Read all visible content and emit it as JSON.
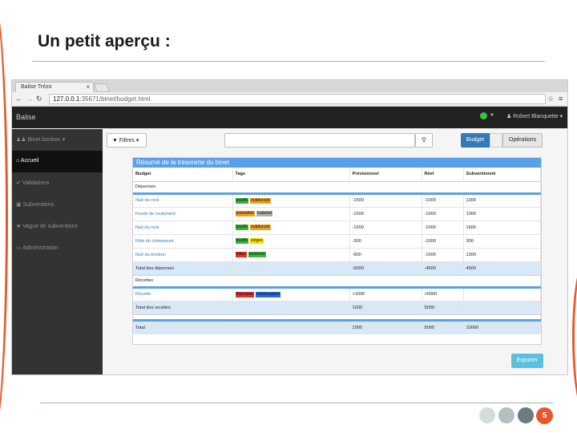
{
  "slide": {
    "title": "Un petit aperçu :",
    "page_number": "5",
    "accent_color": "#e8572a",
    "dot_colors": [
      "#d6dcde",
      "#b4bfc2",
      "#6b7b80"
    ]
  },
  "browser": {
    "tab_title": "Balise Trézo",
    "tab_close": "×",
    "url_host": "127.0.0.1",
    "url_path": ":35671/binet/budget.html"
  },
  "navbar": {
    "brand": "Balise",
    "user": "Robert Blanquette"
  },
  "sidebar": {
    "items": [
      {
        "label": "Binet bonbon ▾"
      },
      {
        "label": "Accueil"
      },
      {
        "label": "Validations"
      },
      {
        "label": "Subventions"
      },
      {
        "label": "Vague de subventions"
      },
      {
        "label": "Administration"
      }
    ]
  },
  "toolbar": {
    "filter_label": "Filtres ▾",
    "search_icon": "search-icon",
    "budget_label": "Budget",
    "operations_label": "Opérations"
  },
  "panel": {
    "title": "Résumé de la trésorerie du binet",
    "headers": [
      "Budget",
      "Tags",
      "Prévisionnel",
      "Réel",
      "Subventionné"
    ],
    "depenses_label": "Dépenses",
    "depenses": [
      {
        "budget": "Nuit du rock",
        "tags": [
          {
            "name": "bouffe",
            "color": "#3cb43c"
          },
          {
            "name": "nuitdurock",
            "color": "#f0a020"
          }
        ],
        "prev": "-1500",
        "reel": "-1000",
        "sub": "1300"
      },
      {
        "budget": "Fonds de roulement",
        "tags": [
          {
            "name": "pisteathle",
            "color": "#f0a020"
          },
          {
            "name": "materiel",
            "color": "#b0b0b0"
          }
        ],
        "prev": "-1500",
        "reel": "-1000",
        "sub": "1000"
      },
      {
        "budget": "Nuit du rock",
        "tags": [
          {
            "name": "bouffe",
            "color": "#3cb43c"
          },
          {
            "name": "nuitdurock",
            "color": "#f0a020"
          }
        ],
        "prev": "-1500",
        "reel": "-1000",
        "sub": "1600"
      },
      {
        "budget": "Fête du chimpanzé",
        "tags": [
          {
            "name": "bouffe",
            "color": "#3cb43c"
          },
          {
            "name": "singes",
            "color": "#f5e000"
          }
        ],
        "prev": "-300",
        "reel": "-1000",
        "sub": "300"
      },
      {
        "budget": "Nuit du bonbon",
        "tags": [
          {
            "name": "folies",
            "color": "#e53030"
          },
          {
            "name": "bonbons",
            "color": "#3cb43c"
          }
        ],
        "prev": "-900",
        "reel": "-1000",
        "sub": "1300"
      }
    ],
    "total_depenses": {
      "label": "Total des dépenses",
      "prev": "-5000",
      "reel": "-4000",
      "sub": "4500"
    },
    "recettes_label": "Recettes",
    "recettes": [
      {
        "budget": "Recette",
        "tags": [
          {
            "name": "blackjack",
            "color": "#e53030"
          },
          {
            "name": "soiréecasino",
            "color": "#2a6ad8"
          }
        ],
        "prev": "+1000",
        "reel": "+5000",
        "sub": ""
      }
    ],
    "total_recettes": {
      "label": "Total des recettes",
      "prev": "1000",
      "reel": "5000",
      "sub": ""
    },
    "total": {
      "label": "Total",
      "prev": "1000",
      "reel": "5000",
      "sub": "10000"
    }
  },
  "export_label": "Exporter"
}
